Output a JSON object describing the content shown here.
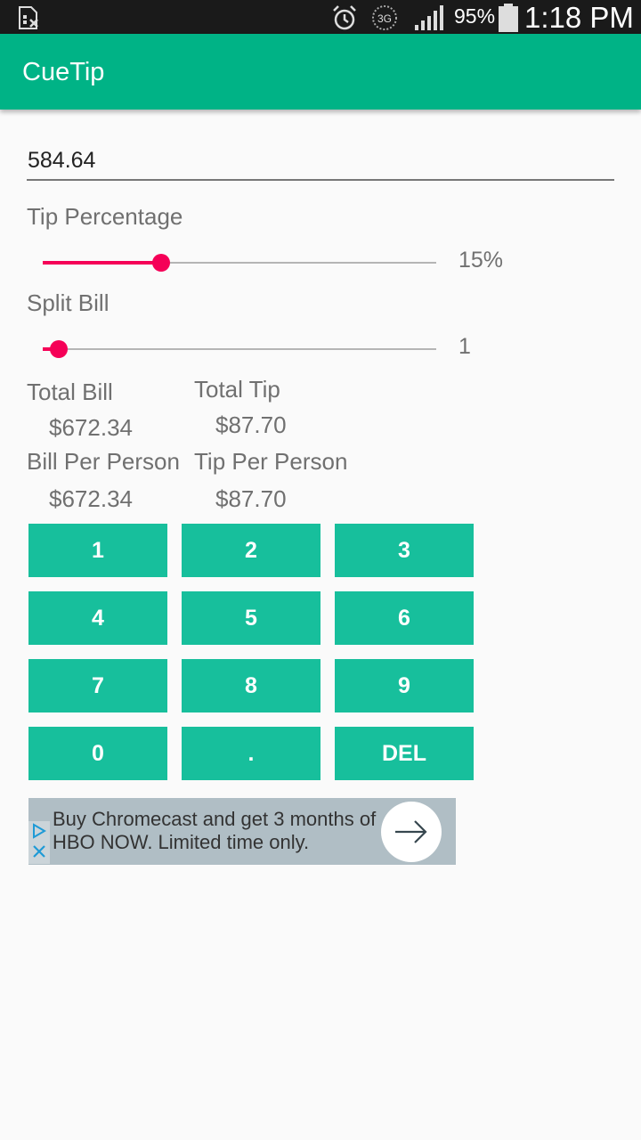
{
  "status_bar": {
    "battery_percent": "95%",
    "time": "1:18 PM",
    "network": "3G",
    "icons": [
      "sim-card-icon",
      "alarm-icon",
      "network-3g-icon",
      "signal-icon",
      "battery-icon"
    ]
  },
  "app": {
    "title": "CueTip",
    "accent_color": "#00b386",
    "slider_color": "#f50057",
    "key_color": "#17bf9c"
  },
  "bill": {
    "value": "584.64"
  },
  "tip": {
    "label": "Tip Percentage",
    "value_text": "15%",
    "slider_fraction": 0.3
  },
  "split": {
    "label": "Split Bill",
    "value_text": "1",
    "slider_fraction": 0.04
  },
  "totals": {
    "total_bill_label": "Total Bill",
    "total_bill_value": "$672.34",
    "total_tip_label": "Total Tip",
    "total_tip_value": "$87.70",
    "bill_per_person_label": "Bill Per Person",
    "bill_per_person_value": "$672.34",
    "tip_per_person_label": "Tip Per Person",
    "tip_per_person_value": "$87.70"
  },
  "keypad": [
    "1",
    "2",
    "3",
    "4",
    "5",
    "6",
    "7",
    "8",
    "9",
    "0",
    ".",
    "DEL"
  ],
  "ad": {
    "line1": "Buy Chromecast and get 3 months of",
    "line2": "HBO NOW. Limited time only.",
    "icons": [
      "adchoices-icon",
      "close-icon",
      "arrow-right-icon"
    ]
  }
}
